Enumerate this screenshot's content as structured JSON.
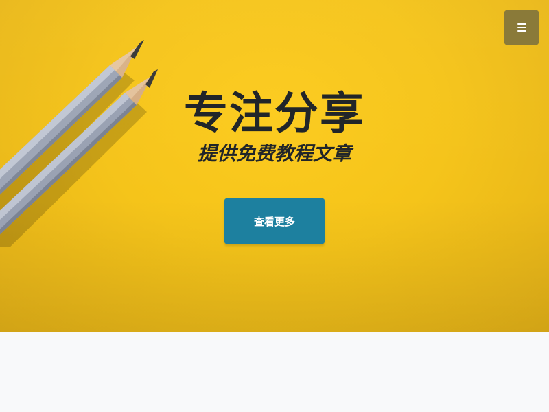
{
  "hero": {
    "title": "专注分享",
    "subtitle": "提供免费教程文章",
    "cta_label": "查看更多",
    "background_color": "#f5c41a"
  },
  "header": {
    "menu_icon": "hamburger-menu-icon",
    "menu_button_color": "#8a7a39"
  },
  "colors": {
    "cta": "#1d809f",
    "text": "#212529",
    "section_bg": "#f8f9fa"
  }
}
